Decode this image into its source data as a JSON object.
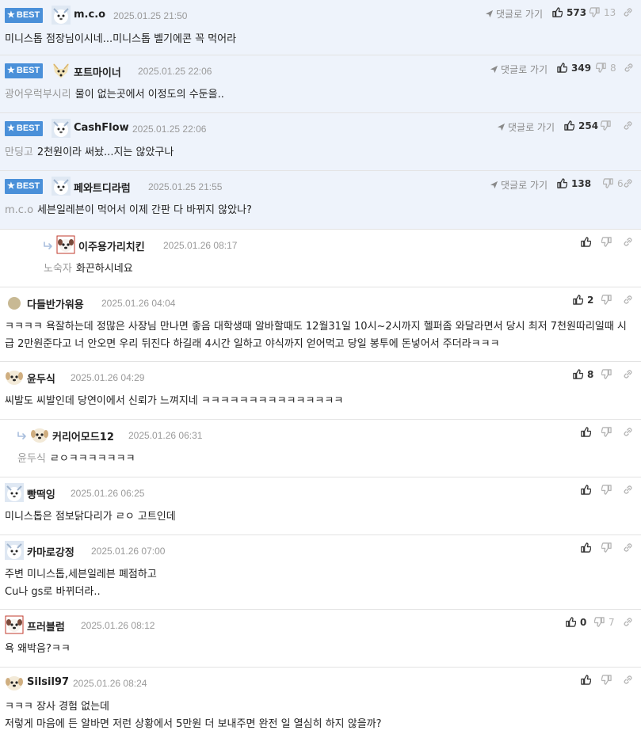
{
  "labels": {
    "best": "BEST",
    "goto": "댓글로 가기"
  },
  "comments": [
    {
      "best": true,
      "name": "m.c.o",
      "date": "2025.01.25 21:50",
      "goto": true,
      "up": "573",
      "down": "13",
      "mention": "",
      "text": "미니스톱 점장님이시네...미니스톱 벨기에콘 꼭 먹어라",
      "avatar": "dog-white"
    },
    {
      "best": true,
      "name": "포트마이너",
      "date": "2025.01.25 22:06",
      "goto": true,
      "up": "349",
      "down": "8",
      "mention": "광어우럭부시리",
      "text": "물이 없는곳에서 이정도의 수둔을..",
      "avatar": "fox"
    },
    {
      "best": true,
      "name": "CashFlow",
      "date": "2025.01.25 22:06",
      "goto": true,
      "up": "254",
      "down": "",
      "mention": "만딩고",
      "text": "2천원이라 써놨...지는 않았구나",
      "avatar": "dog-white"
    },
    {
      "best": true,
      "name": "페와트디라럼",
      "date": "2025.01.25 21:55",
      "goto": true,
      "up": "138",
      "down": "6",
      "mention": "m.c.o",
      "text": "세븐일레븐이 먹어서 이제 간판 다 바뀌지 않았나?",
      "avatar": "dog-white"
    },
    {
      "best": false,
      "reply": 1,
      "name": "이주용가리치킨",
      "date": "2025.01.26 08:17",
      "up": "",
      "down": "",
      "mention": "노숙자",
      "text": "화끈하시네요",
      "avatar": "dog-red"
    },
    {
      "best": false,
      "name": "다들반가워용",
      "date": "2025.01.26 04:04",
      "up": "2",
      "down": "",
      "mention": "",
      "text": "ㅋㅋㅋㅋ 욕잘하는데 정많은 사장님 만나면 좋음 대학생때 알바할때도 12월31일 10시~2시까지 헬퍼좀 와달라면서 당시 최저 7천원따리일때 시급 2만원준다고 너 안오면 우리 뒤진다 하길래 4시간 일하고 야식까지 얻어먹고 당일 봉투에 돈넣어서 주더라ㅋㅋㅋ",
      "avatar": "dot"
    },
    {
      "best": false,
      "name": "윤두식",
      "date": "2025.01.26 04:29",
      "up": "8",
      "down": "",
      "mention": "",
      "text": "씨발도 씨발인데 당연이에서 신뢰가 느껴지네 ㅋㅋㅋㅋㅋㅋㅋㅋㅋㅋㅋㅋㅋㅋㅋ",
      "avatar": "dog-tan"
    },
    {
      "best": false,
      "reply": 2,
      "name": "커리어모드12",
      "date": "2025.01.26 06:31",
      "up": "",
      "down": "",
      "mention": "윤두식",
      "text": "ㄹㅇㅋㅋㅋㅋㅋㅋㅋ",
      "avatar": "dog-tan"
    },
    {
      "best": false,
      "name": "빵떡잉",
      "date": "2025.01.26 06:25",
      "up": "",
      "down": "",
      "mention": "",
      "text": "미니스톱은 점보닭다리가 ㄹㅇ 고트인데",
      "avatar": "dog-white"
    },
    {
      "best": false,
      "name": "카마로강정",
      "date": "2025.01.26 07:00",
      "up": "",
      "down": "",
      "mention": "",
      "text": "주변 미니스톱,세븐일레븐 폐점하고\nCu나 gs로 바뀌더라..",
      "avatar": "dog-white"
    },
    {
      "best": false,
      "name": "프러블럼",
      "date": "2025.01.26 08:12",
      "up": "0",
      "down": "7",
      "mention": "",
      "text": "욕 왜박음?ㅋㅋ",
      "avatar": "dog-red"
    },
    {
      "best": false,
      "name": "Silsil97",
      "date": "2025.01.26 08:24",
      "up": "",
      "down": "",
      "mention": "",
      "text": "ㅋㅋㅋ 장사 경험 없는데\n저렇게 마음에 든 알바면 저런 상황에서 5만원 더 보내주면 완전 일 열심히 하지 않을까?",
      "avatar": "dog-tan"
    }
  ]
}
